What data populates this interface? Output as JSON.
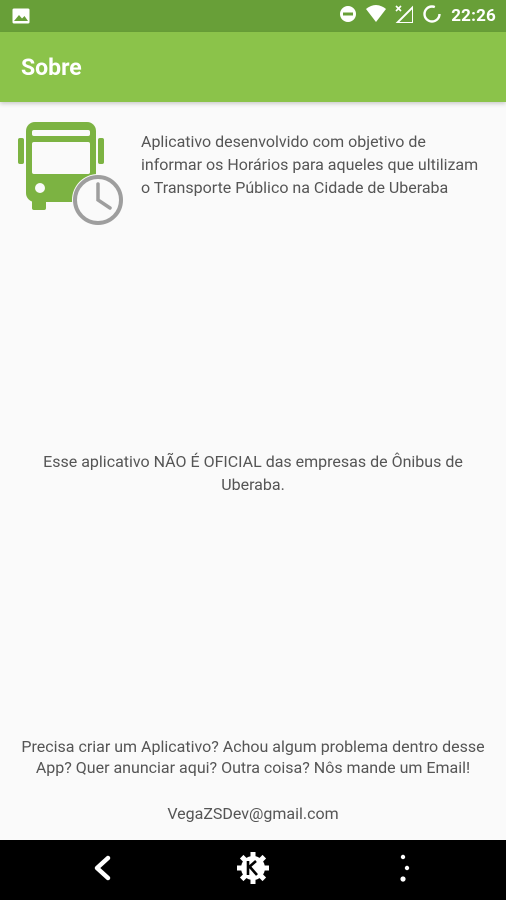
{
  "status_bar": {
    "time": "22:26",
    "icons": [
      "image-icon",
      "do-not-disturb-icon",
      "wifi-icon",
      "signal-no-data-icon",
      "battery-charging-icon"
    ]
  },
  "app_bar": {
    "title": "Sobre",
    "color": "#8bc34a",
    "status_color": "#689f38"
  },
  "about": {
    "logo": "bus-clock-icon",
    "description": "Aplicativo desenvolvido com objetivo de informar os Horários para aqueles que ultilizam o Transporte Público na Cidade de Uberaba"
  },
  "disclaimer": "Esse aplicativo NÃO É OFICIAL das empresas de Ônibus de Uberaba.",
  "contact": {
    "message": "Precisa criar um Aplicativo? Achou algum problema dentro desse App? Quer anunciar aqui? Outra coisa? Nôs mande um Email!",
    "email": "VegaZSDev@gmail.com"
  },
  "nav_bar": {
    "icons": [
      "back-icon",
      "kde-home-icon",
      "menu-dots-icon"
    ]
  }
}
